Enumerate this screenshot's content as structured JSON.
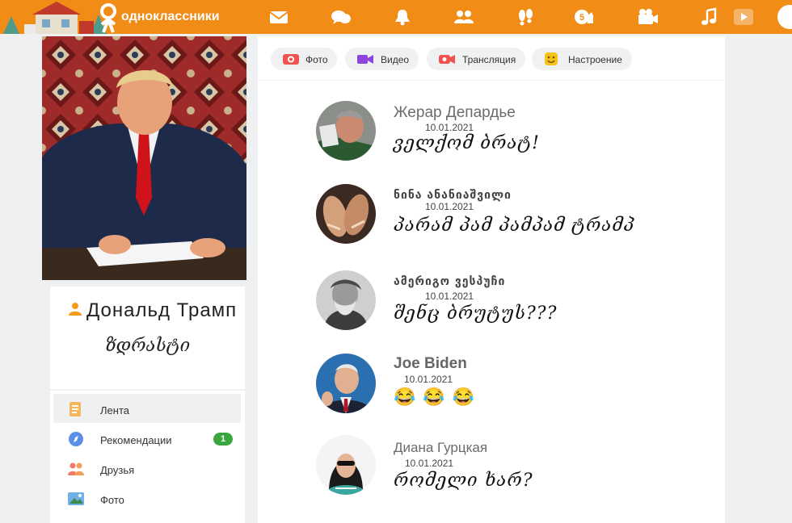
{
  "header": {
    "logo_text": "одноклассники",
    "nav_icons": [
      "mail-icon",
      "messages-icon",
      "bell-icon",
      "friends-icon",
      "guests-icon",
      "events-icon",
      "video-icon",
      "music-icon",
      "play-icon"
    ],
    "badge_count": "5",
    "accent": "#f18c17"
  },
  "profile": {
    "name": "Дональд  Трамп",
    "status": "ზდრასტი"
  },
  "menu": {
    "items": [
      {
        "label": "Лента",
        "icon": "feed-icon"
      },
      {
        "label": "Рекомендации",
        "icon": "compass-icon",
        "badge": "1"
      },
      {
        "label": "Друзья",
        "icon": "friends-icon"
      },
      {
        "label": "Фото",
        "icon": "photo-icon"
      }
    ]
  },
  "tabs": [
    {
      "label": "Фото"
    },
    {
      "label": "Видео"
    },
    {
      "label": "Трансляция"
    },
    {
      "label": "Настроение"
    }
  ],
  "posts": [
    {
      "name": "Жерар  Депардье",
      "date": "10.01.2021",
      "text": "ველქომ ბრატ!"
    },
    {
      "name": "ნინა ანანიაშვილი",
      "date": "10.01.2021",
      "text": "პარამ პამ პამპამ ტრამპ"
    },
    {
      "name": "ამერიგო ვესპუჩი",
      "date": "10.01.2021",
      "text": "შენც ბრუტუს???"
    },
    {
      "name": "Joe Biden",
      "date": "10.01.2021",
      "text": "😂 😂 😂"
    },
    {
      "name": "Диана Гурцкая",
      "date": "10.01.2021",
      "text": "რომელი ხარ?"
    }
  ]
}
